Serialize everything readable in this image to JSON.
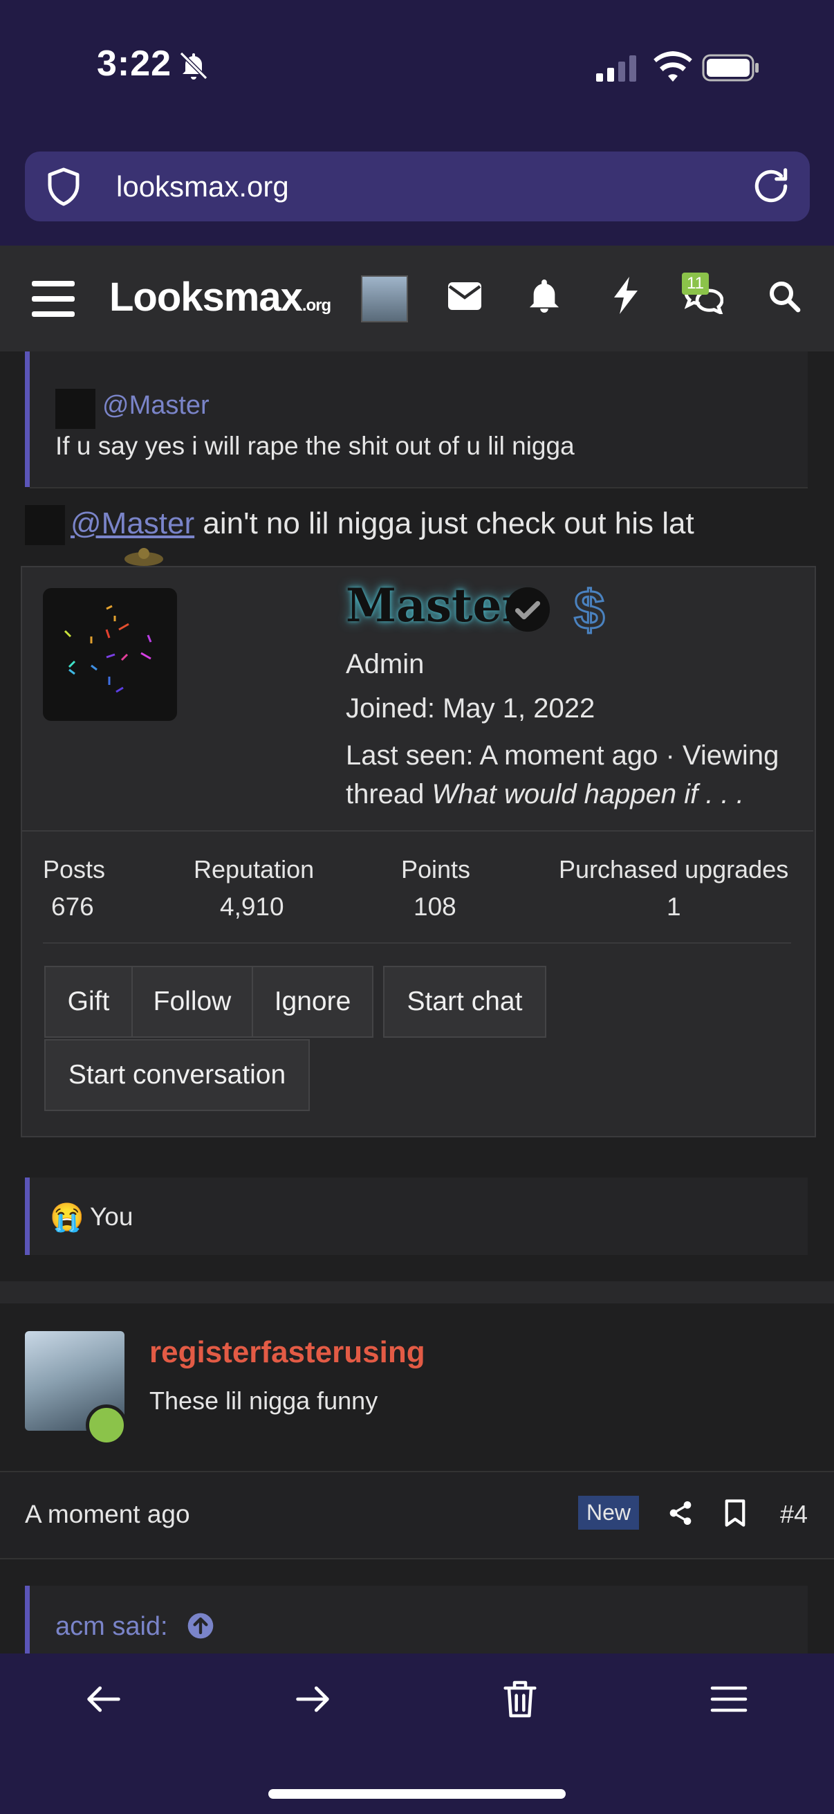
{
  "status_bar": {
    "time": "3:22"
  },
  "browser": {
    "url": "looksmax.org"
  },
  "site_nav": {
    "logo_main": "Looksmax",
    "logo_suffix": ".org",
    "chat_badge": "11"
  },
  "quote_top": {
    "mention": "@Master",
    "text": "If u say yes i will rape the shit out of u lil nigga"
  },
  "reply_line": {
    "mention": "@Master",
    "text": " ain't no lil nigga just check out his lat"
  },
  "member_card": {
    "name": "Master",
    "role": "Admin",
    "joined": "Joined: May 1, 2022",
    "last_seen_prefix": "Last seen: A moment ago · Viewing thread ",
    "last_seen_thread": "What would happen if . . .",
    "stats": [
      {
        "label": "Posts",
        "value": "676"
      },
      {
        "label": "Reputation",
        "value": "4,910"
      },
      {
        "label": "Points",
        "value": "108"
      },
      {
        "label": "Purchased upgrades",
        "value": "1"
      }
    ],
    "buttons": {
      "gift": "Gift",
      "follow": "Follow",
      "ignore": "Ignore",
      "start_chat": "Start chat",
      "start_conversation": "Start conversation"
    }
  },
  "reaction_quote": {
    "emoji": "😭",
    "text": "You"
  },
  "post": {
    "username": "registerfasterusing",
    "title": "These lil nigga funny",
    "time": "A moment ago",
    "new_label": "New",
    "number": "#4",
    "quote_author": "acm said:"
  }
}
